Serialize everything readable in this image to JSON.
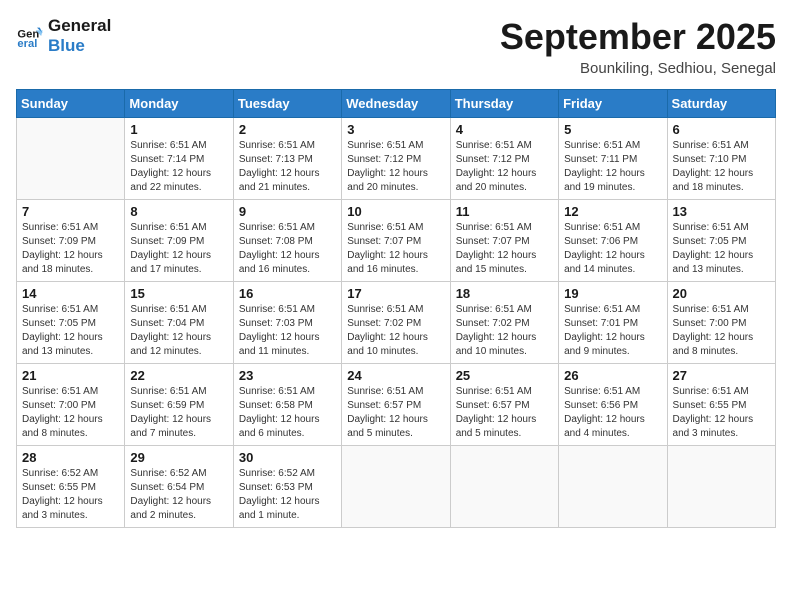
{
  "logo": {
    "line1": "General",
    "line2": "Blue"
  },
  "title": "September 2025",
  "subtitle": "Bounkiling, Sedhiou, Senegal",
  "weekdays": [
    "Sunday",
    "Monday",
    "Tuesday",
    "Wednesday",
    "Thursday",
    "Friday",
    "Saturday"
  ],
  "weeks": [
    [
      {
        "day": "",
        "info": ""
      },
      {
        "day": "1",
        "info": "Sunrise: 6:51 AM\nSunset: 7:14 PM\nDaylight: 12 hours\nand 22 minutes."
      },
      {
        "day": "2",
        "info": "Sunrise: 6:51 AM\nSunset: 7:13 PM\nDaylight: 12 hours\nand 21 minutes."
      },
      {
        "day": "3",
        "info": "Sunrise: 6:51 AM\nSunset: 7:12 PM\nDaylight: 12 hours\nand 20 minutes."
      },
      {
        "day": "4",
        "info": "Sunrise: 6:51 AM\nSunset: 7:12 PM\nDaylight: 12 hours\nand 20 minutes."
      },
      {
        "day": "5",
        "info": "Sunrise: 6:51 AM\nSunset: 7:11 PM\nDaylight: 12 hours\nand 19 minutes."
      },
      {
        "day": "6",
        "info": "Sunrise: 6:51 AM\nSunset: 7:10 PM\nDaylight: 12 hours\nand 18 minutes."
      }
    ],
    [
      {
        "day": "7",
        "info": "Sunrise: 6:51 AM\nSunset: 7:09 PM\nDaylight: 12 hours\nand 18 minutes."
      },
      {
        "day": "8",
        "info": "Sunrise: 6:51 AM\nSunset: 7:09 PM\nDaylight: 12 hours\nand 17 minutes."
      },
      {
        "day": "9",
        "info": "Sunrise: 6:51 AM\nSunset: 7:08 PM\nDaylight: 12 hours\nand 16 minutes."
      },
      {
        "day": "10",
        "info": "Sunrise: 6:51 AM\nSunset: 7:07 PM\nDaylight: 12 hours\nand 16 minutes."
      },
      {
        "day": "11",
        "info": "Sunrise: 6:51 AM\nSunset: 7:07 PM\nDaylight: 12 hours\nand 15 minutes."
      },
      {
        "day": "12",
        "info": "Sunrise: 6:51 AM\nSunset: 7:06 PM\nDaylight: 12 hours\nand 14 minutes."
      },
      {
        "day": "13",
        "info": "Sunrise: 6:51 AM\nSunset: 7:05 PM\nDaylight: 12 hours\nand 13 minutes."
      }
    ],
    [
      {
        "day": "14",
        "info": "Sunrise: 6:51 AM\nSunset: 7:05 PM\nDaylight: 12 hours\nand 13 minutes."
      },
      {
        "day": "15",
        "info": "Sunrise: 6:51 AM\nSunset: 7:04 PM\nDaylight: 12 hours\nand 12 minutes."
      },
      {
        "day": "16",
        "info": "Sunrise: 6:51 AM\nSunset: 7:03 PM\nDaylight: 12 hours\nand 11 minutes."
      },
      {
        "day": "17",
        "info": "Sunrise: 6:51 AM\nSunset: 7:02 PM\nDaylight: 12 hours\nand 10 minutes."
      },
      {
        "day": "18",
        "info": "Sunrise: 6:51 AM\nSunset: 7:02 PM\nDaylight: 12 hours\nand 10 minutes."
      },
      {
        "day": "19",
        "info": "Sunrise: 6:51 AM\nSunset: 7:01 PM\nDaylight: 12 hours\nand 9 minutes."
      },
      {
        "day": "20",
        "info": "Sunrise: 6:51 AM\nSunset: 7:00 PM\nDaylight: 12 hours\nand 8 minutes."
      }
    ],
    [
      {
        "day": "21",
        "info": "Sunrise: 6:51 AM\nSunset: 7:00 PM\nDaylight: 12 hours\nand 8 minutes."
      },
      {
        "day": "22",
        "info": "Sunrise: 6:51 AM\nSunset: 6:59 PM\nDaylight: 12 hours\nand 7 minutes."
      },
      {
        "day": "23",
        "info": "Sunrise: 6:51 AM\nSunset: 6:58 PM\nDaylight: 12 hours\nand 6 minutes."
      },
      {
        "day": "24",
        "info": "Sunrise: 6:51 AM\nSunset: 6:57 PM\nDaylight: 12 hours\nand 5 minutes."
      },
      {
        "day": "25",
        "info": "Sunrise: 6:51 AM\nSunset: 6:57 PM\nDaylight: 12 hours\nand 5 minutes."
      },
      {
        "day": "26",
        "info": "Sunrise: 6:51 AM\nSunset: 6:56 PM\nDaylight: 12 hours\nand 4 minutes."
      },
      {
        "day": "27",
        "info": "Sunrise: 6:51 AM\nSunset: 6:55 PM\nDaylight: 12 hours\nand 3 minutes."
      }
    ],
    [
      {
        "day": "28",
        "info": "Sunrise: 6:52 AM\nSunset: 6:55 PM\nDaylight: 12 hours\nand 3 minutes."
      },
      {
        "day": "29",
        "info": "Sunrise: 6:52 AM\nSunset: 6:54 PM\nDaylight: 12 hours\nand 2 minutes."
      },
      {
        "day": "30",
        "info": "Sunrise: 6:52 AM\nSunset: 6:53 PM\nDaylight: 12 hours\nand 1 minute."
      },
      {
        "day": "",
        "info": ""
      },
      {
        "day": "",
        "info": ""
      },
      {
        "day": "",
        "info": ""
      },
      {
        "day": "",
        "info": ""
      }
    ]
  ]
}
